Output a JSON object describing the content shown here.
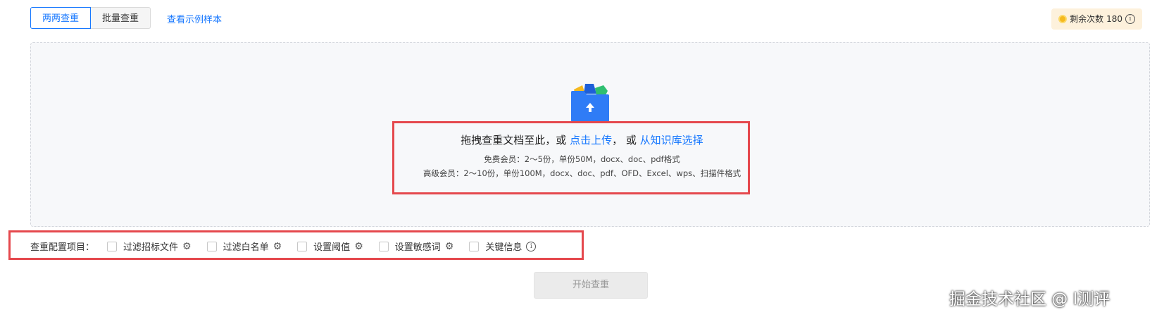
{
  "tabs": [
    {
      "label": "两两查重",
      "active": true
    },
    {
      "label": "批量查重",
      "active": false
    }
  ],
  "sample_link": "查看示例样本",
  "quota": {
    "label": "剩余次数",
    "count": "180"
  },
  "upload": {
    "prefix": "拖拽查重文档至此，或",
    "upload_link": "点击上传",
    "middle": "， 或",
    "kb_link": "从知识库选择",
    "free_note": "免费会员：2～5份，单份50M，docx、doc、pdf格式",
    "premium_note": "高级会员：2～10份，单份100M，docx、doc、pdf、OFD、Excel、wps、扫描件格式"
  },
  "config": {
    "title": "查重配置项目：",
    "options": [
      {
        "label": "过滤招标文件",
        "icon": "gear-icon"
      },
      {
        "label": "过滤白名单",
        "icon": "gear-icon"
      },
      {
        "label": "设置阈值",
        "icon": "gear-icon"
      },
      {
        "label": "设置敏感词",
        "icon": "gear-icon"
      },
      {
        "label": "关键信息",
        "icon": "info-icon"
      }
    ]
  },
  "start_button": "开始查重",
  "watermark": "掘金技术社区 @ I测评",
  "colors": {
    "accent": "#1677ff",
    "highlight_border": "#e5484d",
    "quota_bg": "#fdf1dc"
  }
}
